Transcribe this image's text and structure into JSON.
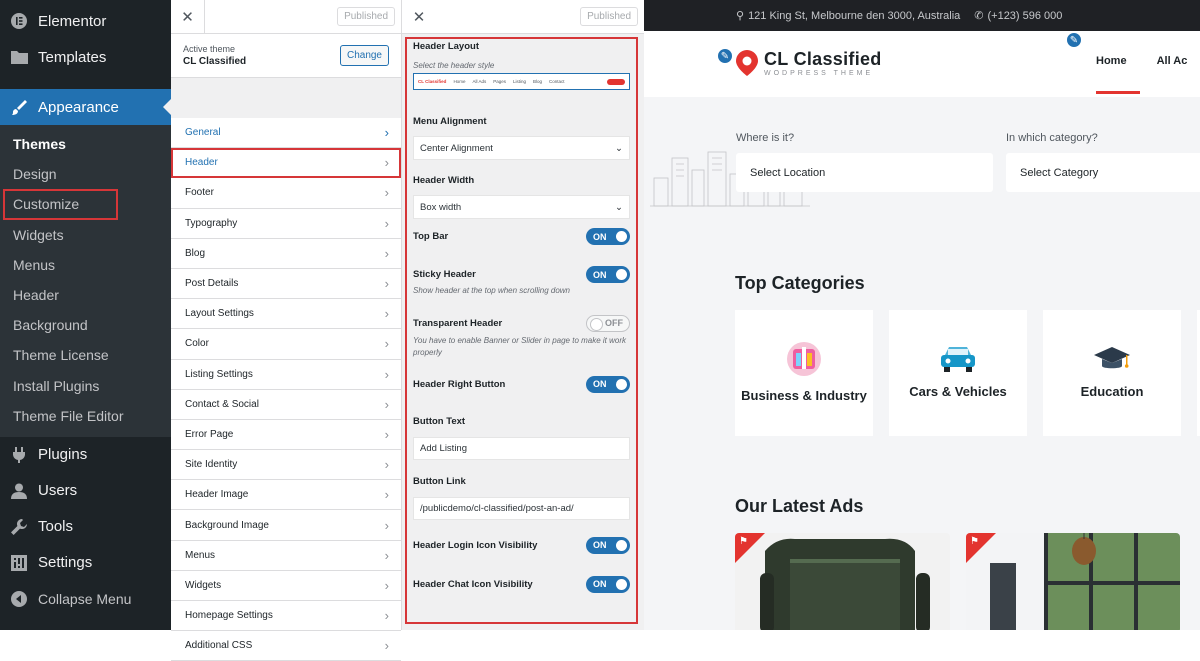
{
  "wp_menu": {
    "elementor": "Elementor",
    "templates": "Templates",
    "appearance": "Appearance",
    "submenu": [
      "Themes",
      "Design",
      "Customize",
      "Widgets",
      "Menus",
      "Header",
      "Background",
      "Theme License",
      "Install Plugins",
      "Theme File Editor"
    ],
    "plugins": "Plugins",
    "users": "Users",
    "tools": "Tools",
    "settings": "Settings",
    "collapse": "Collapse Menu"
  },
  "customizer": {
    "close": "✕",
    "published": "Published",
    "active_theme_label": "Active theme",
    "active_theme_name": "CL Classified",
    "change": "Change",
    "sections": [
      "General",
      "Header",
      "Footer",
      "Typography",
      "Blog",
      "Post Details",
      "Layout Settings",
      "Color",
      "Listing Settings",
      "Contact & Social",
      "Error Page",
      "Site Identity",
      "Header Image",
      "Background Image",
      "Menus",
      "Widgets",
      "Homepage Settings",
      "Additional CSS"
    ]
  },
  "header_panel": {
    "close": "✕",
    "published": "Published",
    "layout_title": "Header Layout",
    "layout_desc": "Select the header style",
    "layout_preview": [
      "CL Classified",
      "Home",
      "All Ads",
      "Pages",
      "Listing",
      "Blog",
      "Contact"
    ],
    "menu_alignment_title": "Menu Alignment",
    "menu_alignment_value": "Center Alignment",
    "header_width_title": "Header Width",
    "header_width_value": "Box width",
    "top_bar": "Top Bar",
    "top_bar_state": "ON",
    "sticky_header": "Sticky Header",
    "sticky_header_state": "ON",
    "sticky_desc": "Show header at the top when scrolling down",
    "transparent_header": "Transparent Header",
    "transparent_state": "OFF",
    "transparent_desc": "You have to enable Banner or Slider in page to make it work properly",
    "header_right_button": "Header Right Button",
    "header_right_state": "ON",
    "button_text_title": "Button Text",
    "button_text_value": "Add Listing",
    "button_link_title": "Button Link",
    "button_link_value": "/publicdemo/cl-classified/post-an-ad/",
    "login_icon": "Header Login Icon Visibility",
    "login_icon_state": "ON",
    "chat_icon": "Header Chat Icon Visibility",
    "chat_icon_state": "ON"
  },
  "site": {
    "address": "121 King St, Melbourne den 3000, Australia",
    "phone": "(+123) 596 000",
    "logo_title": "CL Classified",
    "logo_sub": "WODPRESS THEME",
    "nav": [
      "Home",
      "All Ac"
    ],
    "where_label": "Where is it?",
    "where_value": "Select Location",
    "category_label": "In which category?",
    "category_value": "Select Category",
    "top_categories": "Top Categories",
    "categories": [
      "Business & Industry",
      "Cars & Vehicles",
      "Education"
    ],
    "latest_ads": "Our Latest Ads"
  },
  "colors": {
    "wp_blue": "#2271b1",
    "highlight_red": "#d63638",
    "brand_red": "#e3342f",
    "admin_dark": "#1d2327"
  }
}
